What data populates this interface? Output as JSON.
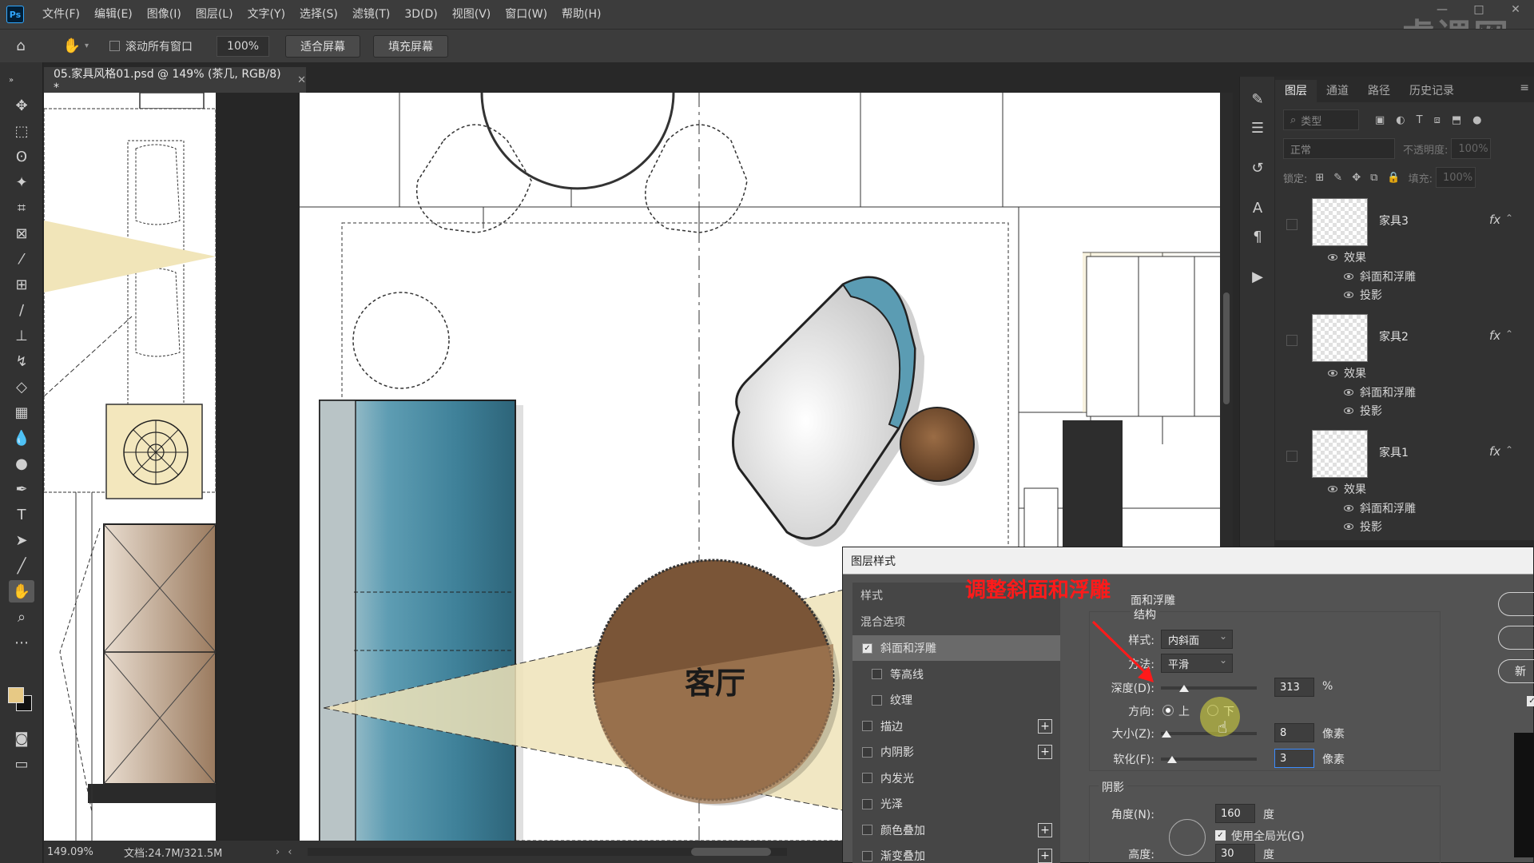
{
  "menubar": {
    "items": [
      "文件(F)",
      "编辑(E)",
      "图像(I)",
      "图层(L)",
      "文字(Y)",
      "选择(S)",
      "滤镜(T)",
      "3D(D)",
      "视图(V)",
      "窗口(W)",
      "帮助(H)"
    ],
    "app_logo": "Ps",
    "watermark": "虎课网"
  },
  "options": {
    "scroll_all_label": "滚动所有窗口",
    "zoom_value": "100%",
    "fit_screen": "适合屏幕",
    "fill_screen": "填充屏幕"
  },
  "document": {
    "tab_title": "05.家具风格01.psd @ 149% (茶几, RGB/8) *",
    "room_label": "客厅",
    "status_zoom": "149.09%",
    "status_doc": "文档:24.7M/321.5M",
    "colors": {
      "teal": "#4f94aa",
      "wood": "#7a5537",
      "beige": "#efe3b8",
      "line": "#333333"
    }
  },
  "layers_panel": {
    "tabs": [
      "图层",
      "通道",
      "路径",
      "历史记录"
    ],
    "active_tab": "图层",
    "filter_label": "类型",
    "blend_mode": "正常",
    "opacity_label": "不透明度:",
    "opacity_value": "100%",
    "lock_label": "锁定:",
    "fill_label": "填充:",
    "fill_value": "100%",
    "layers": [
      {
        "name": "家具3",
        "effects_label": "效果",
        "effects": [
          "斜面和浮雕",
          "投影"
        ]
      },
      {
        "name": "家具2",
        "effects_label": "效果",
        "effects": [
          "斜面和浮雕",
          "投影"
        ]
      },
      {
        "name": "家具1",
        "effects_label": "效果",
        "effects": [
          "斜面和浮雕",
          "投影"
        ]
      }
    ]
  },
  "dialog": {
    "title": "图层样式",
    "list_header_styles": "样式",
    "list_header_blend": "混合选项",
    "items": [
      {
        "label": "斜面和浮雕",
        "checked": true,
        "selected": true,
        "sub": false,
        "plus": false
      },
      {
        "label": "等高线",
        "checked": false,
        "selected": false,
        "sub": true,
        "plus": false
      },
      {
        "label": "纹理",
        "checked": false,
        "selected": false,
        "sub": true,
        "plus": false
      },
      {
        "label": "描边",
        "checked": false,
        "selected": false,
        "sub": false,
        "plus": true
      },
      {
        "label": "内阴影",
        "checked": false,
        "selected": false,
        "sub": false,
        "plus": true
      },
      {
        "label": "内发光",
        "checked": false,
        "selected": false,
        "sub": false,
        "plus": false
      },
      {
        "label": "光泽",
        "checked": false,
        "selected": false,
        "sub": false,
        "plus": false
      },
      {
        "label": "颜色叠加",
        "checked": false,
        "selected": false,
        "sub": false,
        "plus": true
      },
      {
        "label": "渐变叠加",
        "checked": false,
        "selected": false,
        "sub": false,
        "plus": true
      }
    ],
    "section_title": "面和浮雕",
    "structure_title": "结构",
    "style_label": "样式:",
    "style_value": "内斜面",
    "technique_label": "方法:",
    "technique_value": "平滑",
    "depth_label": "深度(D):",
    "depth_value": "313",
    "depth_unit": "%",
    "depth_fraction": 0.24,
    "direction_label": "方向:",
    "direction_up": "上",
    "direction_down": "下",
    "size_label": "大小(Z):",
    "size_value": "8",
    "size_unit": "像素",
    "size_fraction": 0.06,
    "soften_label": "软化(F):",
    "soften_value": "3",
    "soften_unit": "像素",
    "soften_fraction": 0.12,
    "shading_title": "阴影",
    "angle_label": "角度(N):",
    "angle_value": "160",
    "angle_unit": "度",
    "global_light_label": "使用全局光(G)",
    "altitude_label": "高度:",
    "altitude_value": "30",
    "altitude_unit": "度",
    "right_button_partial": "新"
  },
  "annotation": {
    "text": "调整斜面和浮雕",
    "color": "#ff1a1a"
  }
}
